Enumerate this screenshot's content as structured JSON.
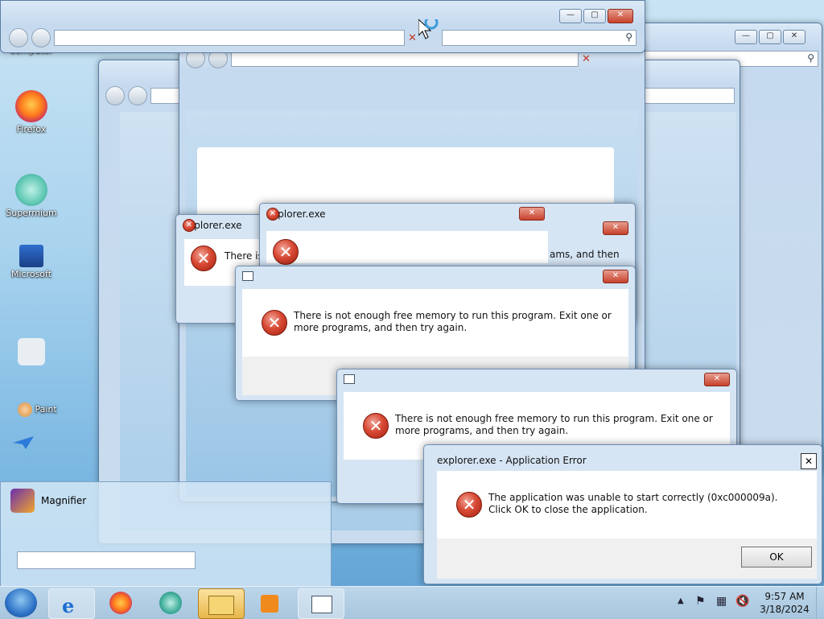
{
  "desktop": {
    "icons": [
      {
        "label": "Computer",
        "icon": "computer-icon"
      },
      {
        "label": "Firefox",
        "icon": "firefox-icon"
      },
      {
        "label": "Supermium",
        "icon": "supermium-icon"
      },
      {
        "label": "Microsoft",
        "icon": "microsoft-icon"
      },
      {
        "label": "Paint",
        "icon": "paint-icon"
      },
      {
        "label": "Magnifier",
        "icon": "magnifier-icon"
      }
    ]
  },
  "dialogs": {
    "d1": {
      "title": "explorer.exe",
      "message": "There is"
    },
    "d2": {
      "title": "explorer.exe",
      "message_right": "ams, and then"
    },
    "d3": {
      "message": "There is not enough free memory to run this program. Exit one or more programs, and then try again."
    },
    "d4": {
      "message": "There is not enough free memory to run this program. Exit one or more programs, and then try again."
    },
    "app_error": {
      "title": "explorer.exe - Application Error",
      "message": "The application was unable to start correctly (0xc000009a). Click OK to close the application.",
      "ok_label": "OK"
    }
  },
  "taskbar": {
    "time": "9:57 AM",
    "date": "3/18/2024"
  }
}
